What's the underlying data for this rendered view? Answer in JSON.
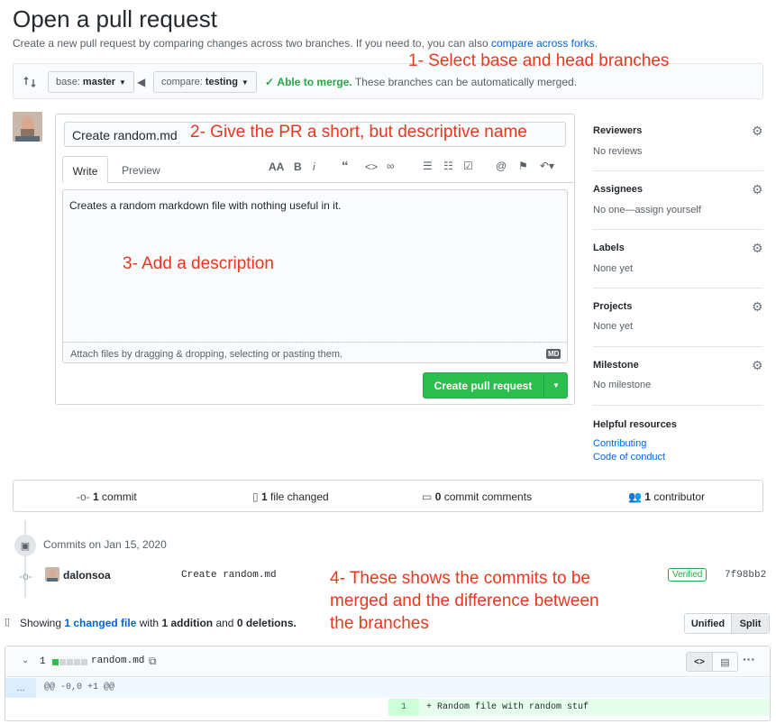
{
  "header": {
    "title": "Open a pull request",
    "subtitle": "Create a new pull request by comparing changes across two branches. If you need to, you can also",
    "fork_link": "compare across forks."
  },
  "branches": {
    "base_label": "base:",
    "base_value": "master",
    "compare_label": "compare:",
    "compare_value": "testing",
    "merge_status": "Able to merge.",
    "merge_detail": "These branches can be automatically merged."
  },
  "annotations": {
    "a1": "1- Select base and head branches",
    "a2": "2- Give the PR a short, but descriptive name",
    "a3": "3- Add a description",
    "a4_l1": "4- These shows the commits to be",
    "a4_l2": "merged and the difference between",
    "a4_l3": "the branches"
  },
  "form": {
    "title_value": "Create random.md",
    "tab_write": "Write",
    "tab_preview": "Preview",
    "body_text": "Creates a random markdown file with nothing useful in it.",
    "attach_hint": "Attach files by dragging & dropping, selecting or pasting them.",
    "markdown_badge": "MD",
    "submit_label": "Create pull request"
  },
  "sidebar": {
    "reviewers_title": "Reviewers",
    "reviewers_value": "No reviews",
    "assignees_title": "Assignees",
    "assignees_value": "No one—assign yourself",
    "labels_title": "Labels",
    "labels_value": "None yet",
    "projects_title": "Projects",
    "projects_value": "None yet",
    "milestone_title": "Milestone",
    "milestone_value": "No milestone",
    "resources_title": "Helpful resources",
    "contributing": "Contributing",
    "conduct": "Code of conduct"
  },
  "stats": {
    "commits_n": "1",
    "commits_label": "commit",
    "files_n": "1",
    "files_label": "file changed",
    "comments_n": "0",
    "comments_label": "commit comments",
    "contributors_n": "1",
    "contributors_label": "contributor"
  },
  "commits": {
    "date_header": "Commits on Jan 15, 2020",
    "author": "dalonsoa",
    "message": "Create random.md",
    "verified": "Verified",
    "sha": "7f98bb2"
  },
  "diff_summary": {
    "showing": "Showing",
    "changed_link": "1 changed file",
    "with": "with",
    "additions": "1 addition",
    "and": "and",
    "deletions": "0 deletions.",
    "unified": "Unified",
    "split": "Split"
  },
  "file": {
    "count": "1",
    "name": "random.md",
    "hunk": "@@ -0,0 +1 @@",
    "ellipsis": "...",
    "line_no": "1",
    "line_text": "+ Random file with random stuf"
  },
  "colors": {
    "accent": "#0366d6",
    "success": "#28a745",
    "annotation": "#e8371d"
  }
}
